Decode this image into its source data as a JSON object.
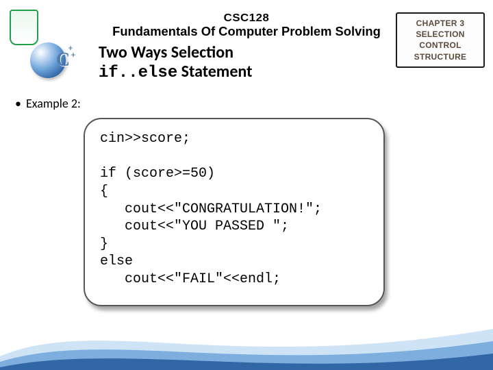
{
  "header": {
    "course_code": "CSC128",
    "course_title": "Fundamentals Of Computer Problem Solving"
  },
  "chapter_box": {
    "line1": "CHAPTER 3",
    "line2": "SELECTION CONTROL",
    "line3": "STRUCTURE"
  },
  "topic": {
    "line1": "Two Ways Selection",
    "mono_part": "if..else",
    "line2_rest": " Statement"
  },
  "bullet": {
    "marker": "•",
    "text": "Example 2:"
  },
  "code": "cin>>score;\n\nif (score>=50)\n{\n   cout<<\"CONGRATULATION!\";\n   cout<<\"YOU PASSED \";\n}\nelse\n   cout<<\"FAIL\"<<endl;",
  "decor": {
    "cpp_letter": "C",
    "plus": "+"
  }
}
